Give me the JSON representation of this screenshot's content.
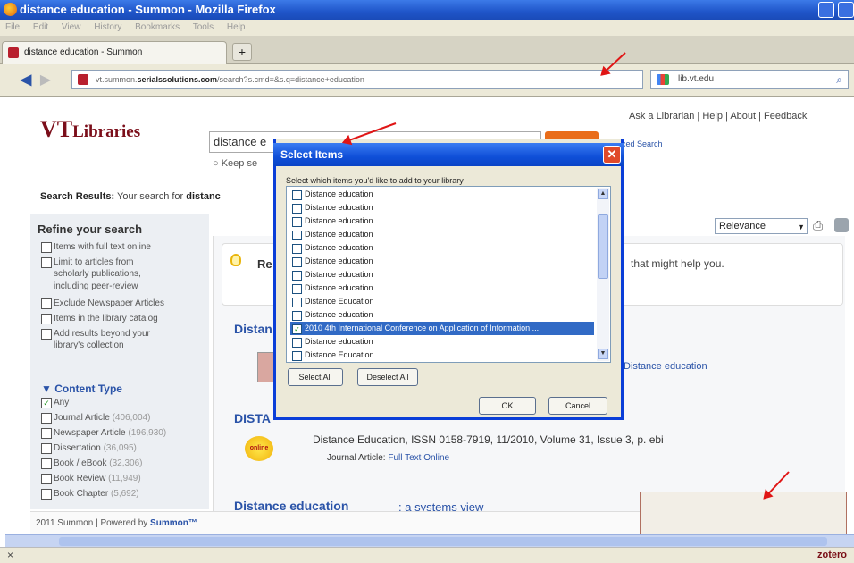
{
  "window": {
    "title": "distance education - Summon - Mozilla Firefox"
  },
  "menu": [
    "File",
    "Edit",
    "View",
    "History",
    "Bookmarks",
    "Tools",
    "Help"
  ],
  "tab": {
    "label": "distance education - Summon",
    "new_tab": "+"
  },
  "nav": {
    "url_prefix": "vt.summon.",
    "url_domain": "serialssolutions.com",
    "url_rest": "/search?s.cmd=&s.q=distance+education",
    "search_engine": "lib.vt.edu"
  },
  "page": {
    "logo_vt": "VT",
    "logo_libraries": "Libraries",
    "top_links": "Ask a Librarian | Help | About | Feedback",
    "search_value": "distance e",
    "advanced_search": "anced Search",
    "keep_search": "Keep se",
    "results_prefix": "Search Results:",
    "results_text": "Your search for",
    "results_query": "distanc",
    "refine_title": "Refine your search",
    "refine_options": [
      "Items with full text online",
      "Limit to articles from",
      "scholarly publications,",
      "including peer-review",
      "Exclude Newspaper Articles",
      "Items in the library catalog",
      "Add results beyond your",
      "library's collection"
    ],
    "content_type_title": "▼ Content Type",
    "content_types": [
      {
        "label": "Any",
        "count": ""
      },
      {
        "label": "Journal Article",
        "count": "(406,004)"
      },
      {
        "label": "Newspaper Article",
        "count": "(196,930)"
      },
      {
        "label": "Dissertation",
        "count": "(36,095)"
      },
      {
        "label": "Book / eBook",
        "count": "(32,306)"
      },
      {
        "label": "Book Review",
        "count": "(11,949)"
      },
      {
        "label": "Book Chapter",
        "count": "(5,692)"
      }
    ],
    "sort": "Relevance",
    "tip_prefix": "Re",
    "tip_suffix": "that might help you.",
    "result1_title": "Distan",
    "result1_line": "Distance education",
    "result2_title": "DISTA",
    "result2_meta": "Distance Education, ISSN 0158-7919, 11/2010, Volume 31, Issue 3, p. ebi",
    "result2_type": "Journal Article:",
    "result2_link": "Full Text Online",
    "online_badge": "online",
    "result3_title": "Distance education",
    "result3_rest": ": a systems view",
    "footer_text": "2011 Summon  |  Powered by",
    "footer_logo": "Summon™"
  },
  "dialog": {
    "title": "Select Items",
    "close": "✕",
    "prompt": "Select which items you'd like to add to your library",
    "items": [
      {
        "label": "Distance education",
        "checked": false
      },
      {
        "label": "Distance education",
        "checked": false
      },
      {
        "label": "Distance education",
        "checked": false
      },
      {
        "label": "Distance education",
        "checked": false
      },
      {
        "label": "Distance education",
        "checked": false
      },
      {
        "label": "Distance education",
        "checked": false
      },
      {
        "label": "Distance education",
        "checked": false
      },
      {
        "label": "Distance education",
        "checked": false
      },
      {
        "label": "Distance Education",
        "checked": false
      },
      {
        "label": "Distance education",
        "checked": false
      },
      {
        "label": "2010 4th International Conference on Application of Information ...",
        "checked": true
      },
      {
        "label": "Distance education",
        "checked": false
      },
      {
        "label": "Distance Education",
        "checked": false
      }
    ],
    "select_all": "Select All",
    "deselect_all": "Deselect All",
    "ok": "OK",
    "cancel": "Cancel"
  },
  "status": {
    "close": "×",
    "zotero": "zotero"
  },
  "colors": {
    "accent": "#0a3ed8",
    "annotation_arrow": "#e01515",
    "vt_maroon": "#7b0e1a"
  }
}
